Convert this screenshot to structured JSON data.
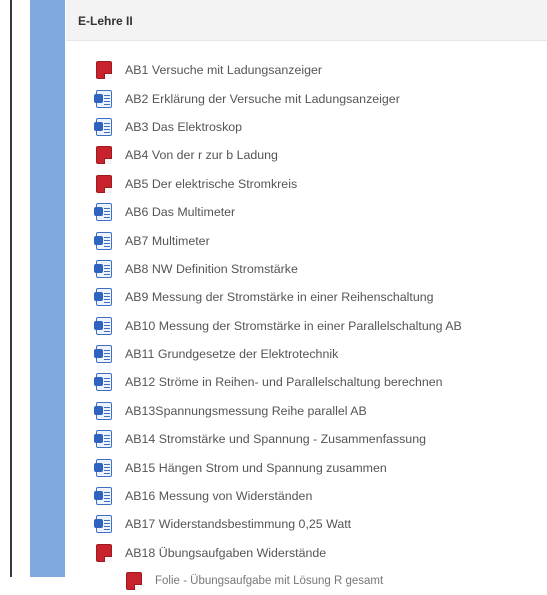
{
  "section": {
    "title": "E-Lehre II"
  },
  "items": [
    {
      "label": "AB1 Versuche mit Ladungsanzeiger",
      "icon": "pdf-icon"
    },
    {
      "label": "AB2 Erklärung der Versuche mit Ladungsanzeiger",
      "icon": "word-doc-icon"
    },
    {
      "label": "AB3 Das Elektroskop",
      "icon": "word-doc-icon"
    },
    {
      "label": "AB4 Von der r zur b Ladung",
      "icon": "pdf-icon"
    },
    {
      "label": "AB5 Der elektrische Stromkreis",
      "icon": "pdf-icon"
    },
    {
      "label": "AB6 Das Multimeter",
      "icon": "word-doc-icon"
    },
    {
      "label": "AB7 Multimeter",
      "icon": "word-doc-icon"
    },
    {
      "label": "AB8 NW Definition Stromstärke",
      "icon": "word-doc-icon"
    },
    {
      "label": "AB9 Messung der Stromstärke in einer Reihenschaltung",
      "icon": "word-doc-icon"
    },
    {
      "label": "AB10 Messung der Stromstärke in einer Parallelschaltung AB",
      "icon": "word-doc-icon"
    },
    {
      "label": "AB11 Grundgesetze der Elektrotechnik",
      "icon": "word-doc-icon"
    },
    {
      "label": "AB12 Ströme in Reihen- und Parallelschaltung berechnen",
      "icon": "word-doc-icon"
    },
    {
      "label": "AB13Spannungsmessung Reihe parallel AB",
      "icon": "word-doc-icon"
    },
    {
      "label": "AB14 Stromstärke und Spannung - Zusammenfassung",
      "icon": "word-doc-icon"
    },
    {
      "label": "AB15 Hängen Strom und Spannung zusammen",
      "icon": "word-doc-icon"
    },
    {
      "label": "AB16 Messung von Widerständen",
      "icon": "word-doc-icon"
    },
    {
      "label": "AB17 Widerstandsbestimmung 0,25 Watt",
      "icon": "word-doc-icon"
    },
    {
      "label": "AB18 Übungsaufgaben Widerstände",
      "icon": "pdf-icon"
    },
    {
      "label": "Folie - Übungsaufgabe mit Lösung R gesamt",
      "icon": "pdf-icon"
    }
  ]
}
